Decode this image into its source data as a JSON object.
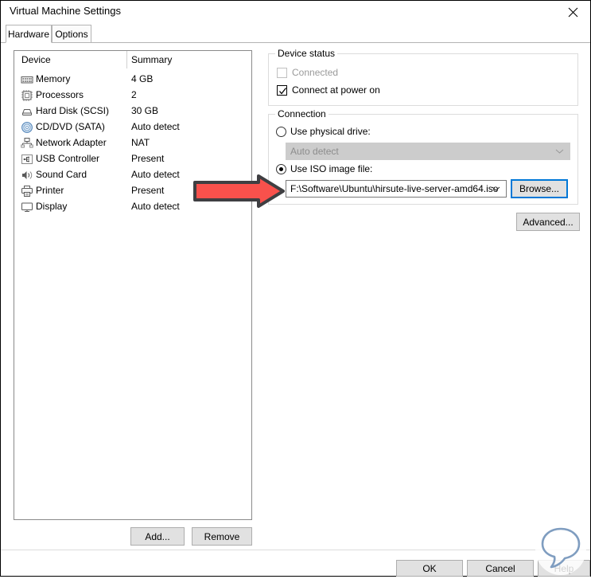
{
  "window": {
    "title": "Virtual Machine Settings",
    "close_icon": "close-icon"
  },
  "tabs": [
    {
      "label": "Hardware",
      "active": true
    },
    {
      "label": "Options",
      "active": false
    }
  ],
  "device_list": {
    "columns": [
      "Device",
      "Summary"
    ],
    "rows": [
      {
        "icon": "memory-icon",
        "device": "Memory",
        "summary": "4 GB"
      },
      {
        "icon": "processor-icon",
        "device": "Processors",
        "summary": "2"
      },
      {
        "icon": "hard-disk-icon",
        "device": "Hard Disk (SCSI)",
        "summary": "30 GB"
      },
      {
        "icon": "cd-dvd-icon",
        "device": "CD/DVD (SATA)",
        "summary": "Auto detect"
      },
      {
        "icon": "network-adapter-icon",
        "device": "Network Adapter",
        "summary": "NAT"
      },
      {
        "icon": "usb-controller-icon",
        "device": "USB Controller",
        "summary": "Present"
      },
      {
        "icon": "sound-card-icon",
        "device": "Sound Card",
        "summary": "Auto detect"
      },
      {
        "icon": "printer-icon",
        "device": "Printer",
        "summary": "Present"
      },
      {
        "icon": "display-icon",
        "device": "Display",
        "summary": "Auto detect"
      }
    ]
  },
  "list_buttons": {
    "add_label": "Add...",
    "remove_label": "Remove"
  },
  "device_status": {
    "title": "Device status",
    "connected": {
      "label": "Connected",
      "checked": false,
      "disabled": true
    },
    "connect_at_power_on": {
      "label": "Connect at power on",
      "checked": true,
      "disabled": false
    }
  },
  "connection": {
    "title": "Connection",
    "use_physical_drive": {
      "label": "Use physical drive:",
      "selected": false
    },
    "physical_drive_value": "Auto detect",
    "use_iso_image": {
      "label": "Use ISO image file:",
      "selected": true
    },
    "iso_path": "F:\\Software\\Ubuntu\\hirsute-live-server-amd64.iso",
    "browse_label": "Browse...",
    "advanced_label": "Advanced..."
  },
  "footer": {
    "ok_label": "OK",
    "cancel_label": "Cancel",
    "help_label": "Help"
  },
  "annotation": {
    "arrow_icon": "red-arrow-icon",
    "arrow_color": "#f9514c",
    "arrow_outline": "#3f3f42"
  },
  "colors": {
    "accent": "#0078d7",
    "disabled_text": "#9a9a9a",
    "group_border": "#dcdcdc",
    "watermark": "#7f9dc0"
  }
}
